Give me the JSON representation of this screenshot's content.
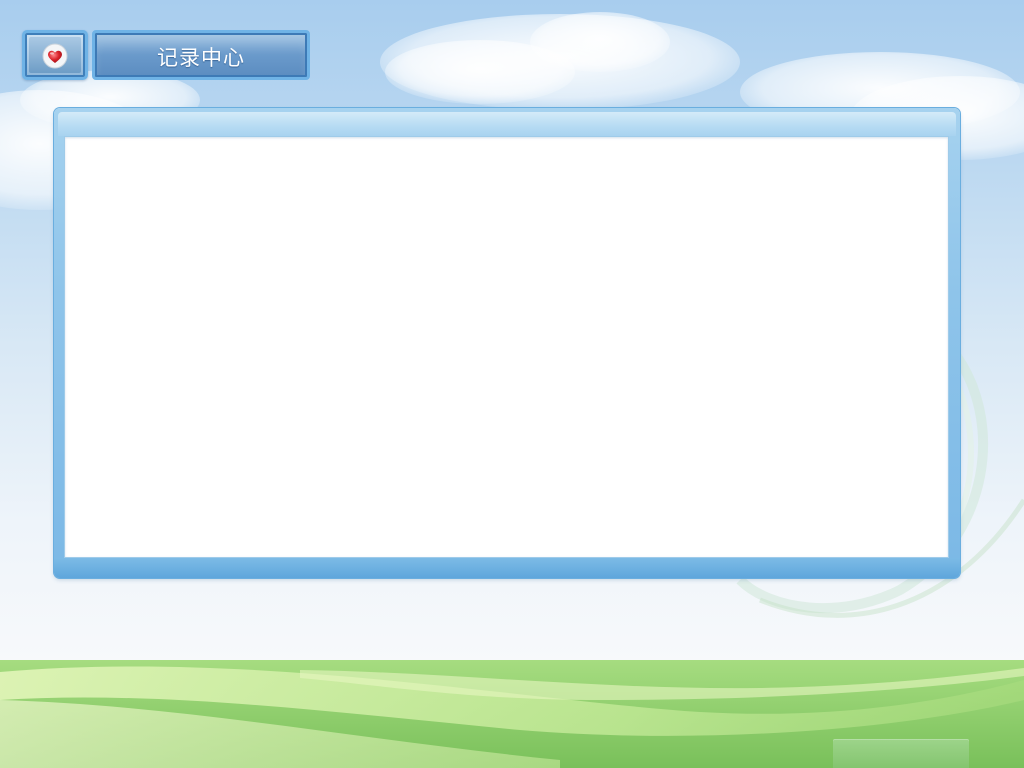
{
  "header": {
    "title": "记录中心",
    "home_icon": "heart-icon"
  },
  "colors": {
    "sky_top": "#a8cdee",
    "panel_border": "#6aaedf",
    "header_box": "#5b8cc0",
    "grass": "#7cc35c",
    "accent_red": "#d9222a"
  }
}
